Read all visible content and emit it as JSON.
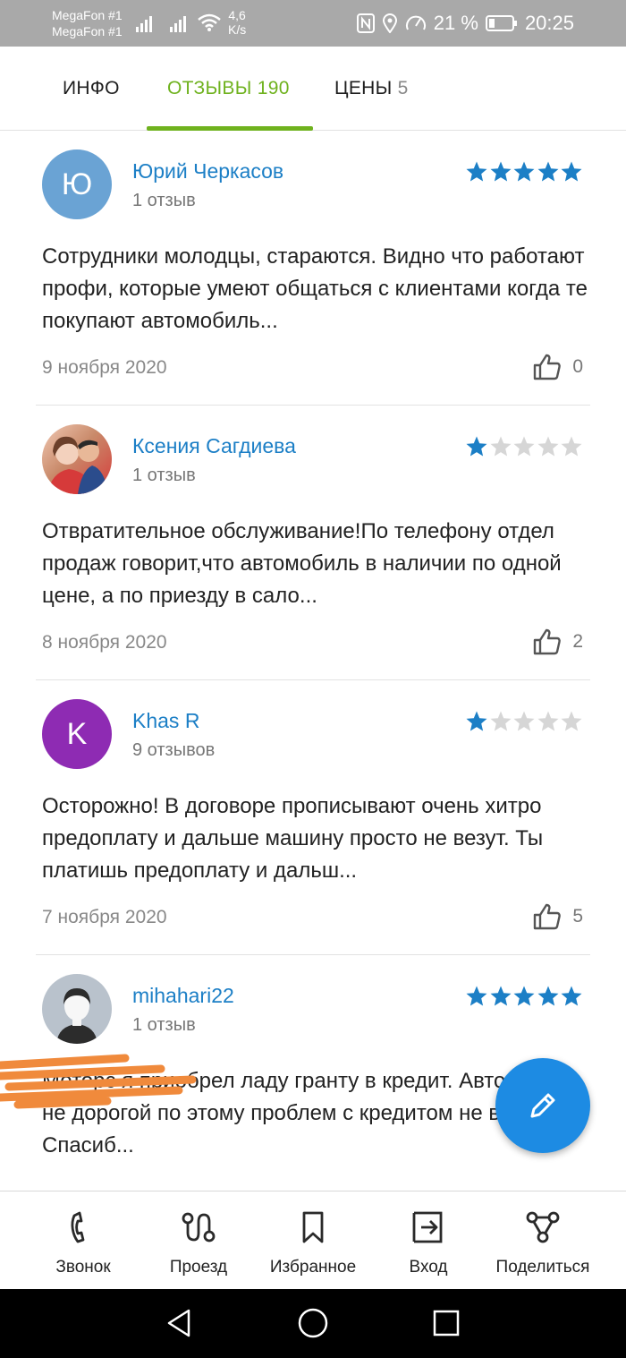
{
  "status_bar": {
    "carrier1": "MegaFon #1",
    "carrier2": "MegaFon #1",
    "speed_value": "4,6",
    "speed_unit": "K/s",
    "battery": "21 %",
    "time": "20:25"
  },
  "tabs": [
    {
      "label": "ИНФО"
    },
    {
      "label": "ОТЗЫВЫ 190"
    },
    {
      "label": "ЦЕНЫ",
      "count": "5"
    }
  ],
  "reviews": [
    {
      "author": "Юрий Черкасов",
      "count": "1 отзыв",
      "avatar_letter": "Ю",
      "avatar_color": "#6aa3d4",
      "rating": 5,
      "text": "Сотрудники молодцы, стараются. Видно что работают профи, которые умеют общаться с клиентами когда те покупают автомобиль...",
      "date": "9 ноября 2020",
      "likes": "0"
    },
    {
      "author": "Ксения Сагдиева",
      "count": "1 отзыв",
      "avatar_letter": "",
      "avatar_color": "#c98a6a",
      "rating": 1,
      "text": "Отвратительное обслуживание!По телефону отдел продаж говорит,что автомобиль в наличии по одной цене, а по приезду в сало...",
      "date": "8 ноября 2020",
      "likes": "2"
    },
    {
      "author": "Khas R",
      "count": "9 отзывов",
      "avatar_letter": "K",
      "avatar_color": "#8e2bb3",
      "rating": 1,
      "text": "Осторожно! В договоре прописывают очень хитро предоплату и дальше машину просто не везут. Ты платишь предоплату и дальш...",
      "date": "7 ноября 2020",
      "likes": "5"
    },
    {
      "author": "mihahari22",
      "count": "1 отзыв",
      "avatar_letter": "",
      "avatar_color": "#b9c2cc",
      "rating": 5,
      "text": "Мотоpc я приобрел ладу гранту в кредит. Автомобиль не дорогой по этому проблем с кредитом не возникло. Спасиб...",
      "date": "",
      "likes": ""
    }
  ],
  "bottom_nav": [
    {
      "label": "Звонок",
      "icon": "phone-icon"
    },
    {
      "label": "Проезд",
      "icon": "route-icon"
    },
    {
      "label": "Избранное",
      "icon": "bookmark-icon"
    },
    {
      "label": "Вход",
      "icon": "entrance-icon"
    },
    {
      "label": "Поделиться",
      "icon": "share-icon"
    }
  ],
  "colors": {
    "accent_green": "#6fb21e",
    "link_blue": "#1c7fc6",
    "star_blue": "#1c7fc6",
    "star_empty": "#d6d6d6",
    "fab_blue": "#1d8be3"
  }
}
